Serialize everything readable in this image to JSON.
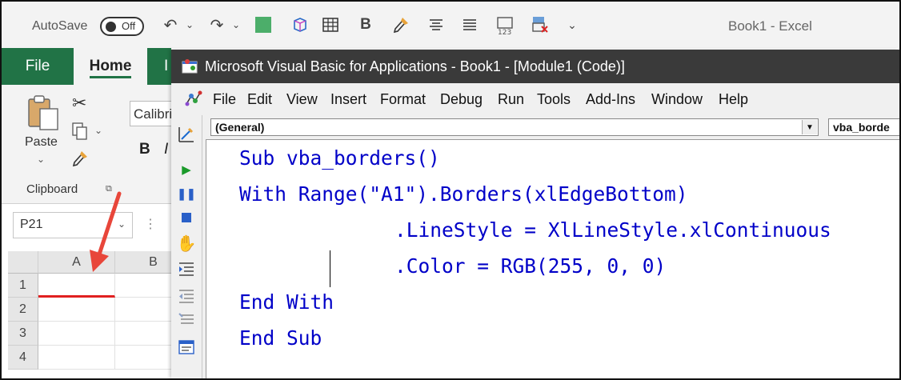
{
  "excel": {
    "autosave_label": "AutoSave",
    "autosave_state": "Off",
    "book_title": "Book1  -  Excel",
    "tabs": {
      "file": "File",
      "home": "Home",
      "insert_partial": "I"
    },
    "clipboard": {
      "paste_label": "Paste",
      "group_label": "Clipboard"
    },
    "font": {
      "name_partial": "Calibri",
      "bold": "B"
    },
    "namebox_value": "P21",
    "columns": [
      "A",
      "B"
    ],
    "rows": [
      "1",
      "2",
      "3",
      "4"
    ],
    "highlight_color": "#e02020",
    "accent_color": "#217346"
  },
  "vba": {
    "title": "Microsoft Visual Basic for Applications - Book1 - [Module1 (Code)]",
    "menu": [
      "File",
      "Edit",
      "View",
      "Insert",
      "Format",
      "Debug",
      "Run",
      "Tools",
      "Add-Ins",
      "Window",
      "Help"
    ],
    "object_combo": "(General)",
    "procedure_combo": "vba_borde",
    "code": {
      "l1_kw": "Sub",
      "l1_rest": " vba_borders()",
      "l2_kw": "With",
      "l2_rest": " Range(\"A1\").Borders(xlEdgeBottom)",
      "l3": ".LineStyle = XlLineStyle.xlContinuous",
      "l4": ".Color = RGB(255, 0, 0)",
      "l5": "End With",
      "l6": "End Sub"
    },
    "keyword_color": "#0000c8"
  }
}
